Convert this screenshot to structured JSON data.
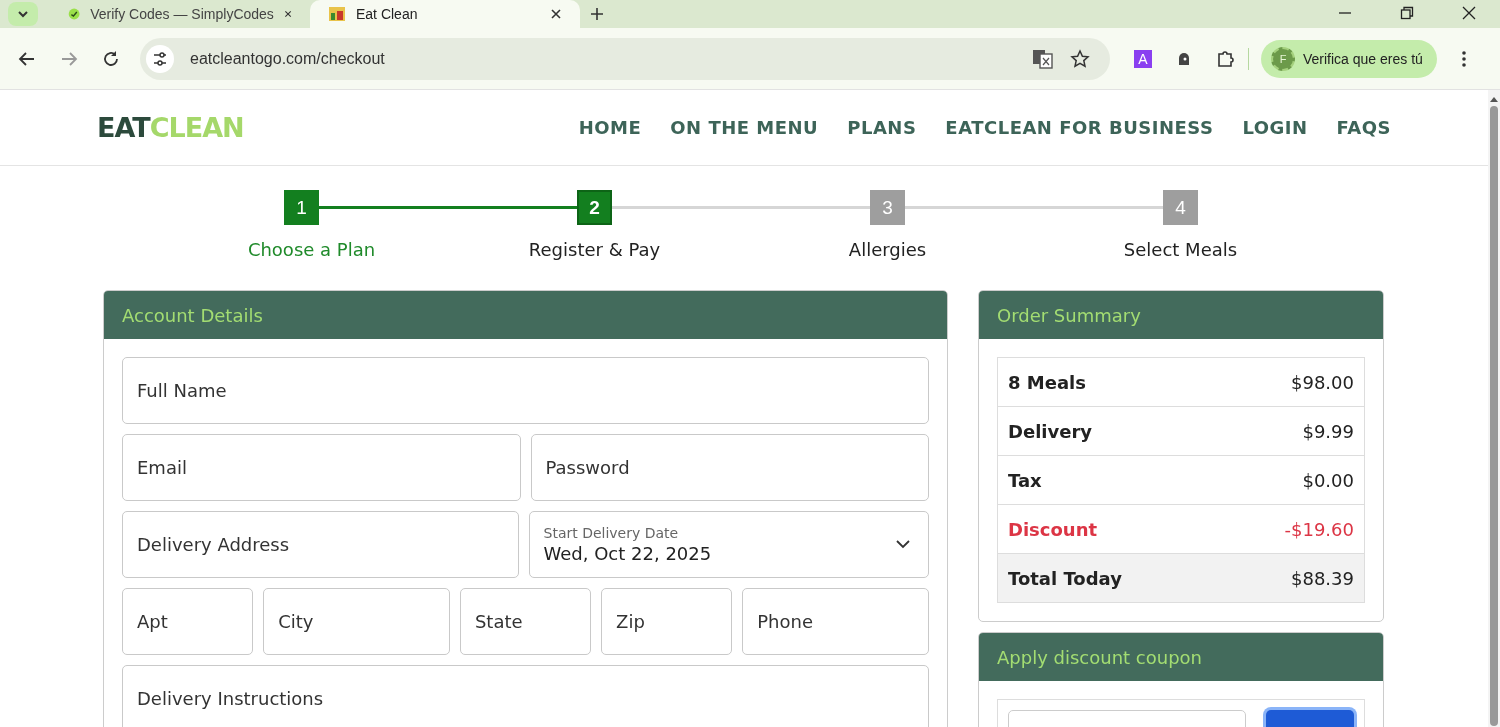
{
  "browser": {
    "tabs": [
      {
        "title": "Verify Codes — SimplyCodes",
        "selected": false
      },
      {
        "title": "Eat Clean",
        "selected": true
      }
    ],
    "url": "eatcleantogo.com/checkout",
    "profile_button": "Verifica que eres tú",
    "profile_initial": "F",
    "extension_letter": "A"
  },
  "header": {
    "logo": {
      "dark_part": "EAT",
      "light_part": "CLEAN"
    },
    "nav": [
      "HOME",
      "ON THE MENU",
      "PLANS",
      "EATCLEAN FOR BUSINESS",
      "LOGIN",
      "FAQS"
    ]
  },
  "steps": [
    {
      "number": "1",
      "label": "Choose a Plan",
      "completed": true,
      "selected": false
    },
    {
      "number": "2",
      "label": "Register & Pay",
      "completed": false,
      "selected": true
    },
    {
      "number": "3",
      "label": "Allergies",
      "completed": false,
      "selected": false
    },
    {
      "number": "4",
      "label": "Select Meals",
      "completed": false,
      "selected": false
    }
  ],
  "account": {
    "title": "Account Details",
    "rows": [
      [
        {
          "placeholder": "Full Name",
          "kind": "text"
        }
      ],
      [
        {
          "placeholder": "Email",
          "kind": "text"
        },
        {
          "placeholder": "Password",
          "kind": "text"
        }
      ],
      [
        {
          "placeholder": "Delivery Address",
          "kind": "text"
        },
        {
          "label": "Start Delivery Date",
          "value": "Wed, Oct 22, 2025",
          "kind": "select"
        }
      ],
      [
        {
          "placeholder": "Apt",
          "kind": "text"
        },
        {
          "placeholder": "City",
          "kind": "text"
        },
        {
          "placeholder": "State",
          "kind": "text"
        },
        {
          "placeholder": "Zip",
          "kind": "text"
        },
        {
          "placeholder": "Phone",
          "kind": "text"
        }
      ],
      [
        {
          "placeholder": "Delivery Instructions",
          "kind": "text"
        }
      ]
    ]
  },
  "summary": {
    "title": "Order Summary",
    "rows": [
      {
        "label": "8 Meals",
        "amount": "$98.00",
        "kind": "normal"
      },
      {
        "label": "Delivery",
        "amount": "$9.99",
        "kind": "normal"
      },
      {
        "label": "Tax",
        "amount": "$0.00",
        "kind": "normal"
      },
      {
        "label": "Discount",
        "amount": "-$19.60",
        "kind": "discount"
      },
      {
        "label": "Total Today",
        "amount": "$88.39",
        "kind": "total"
      }
    ]
  },
  "coupon": {
    "title": "Apply discount coupon"
  }
}
